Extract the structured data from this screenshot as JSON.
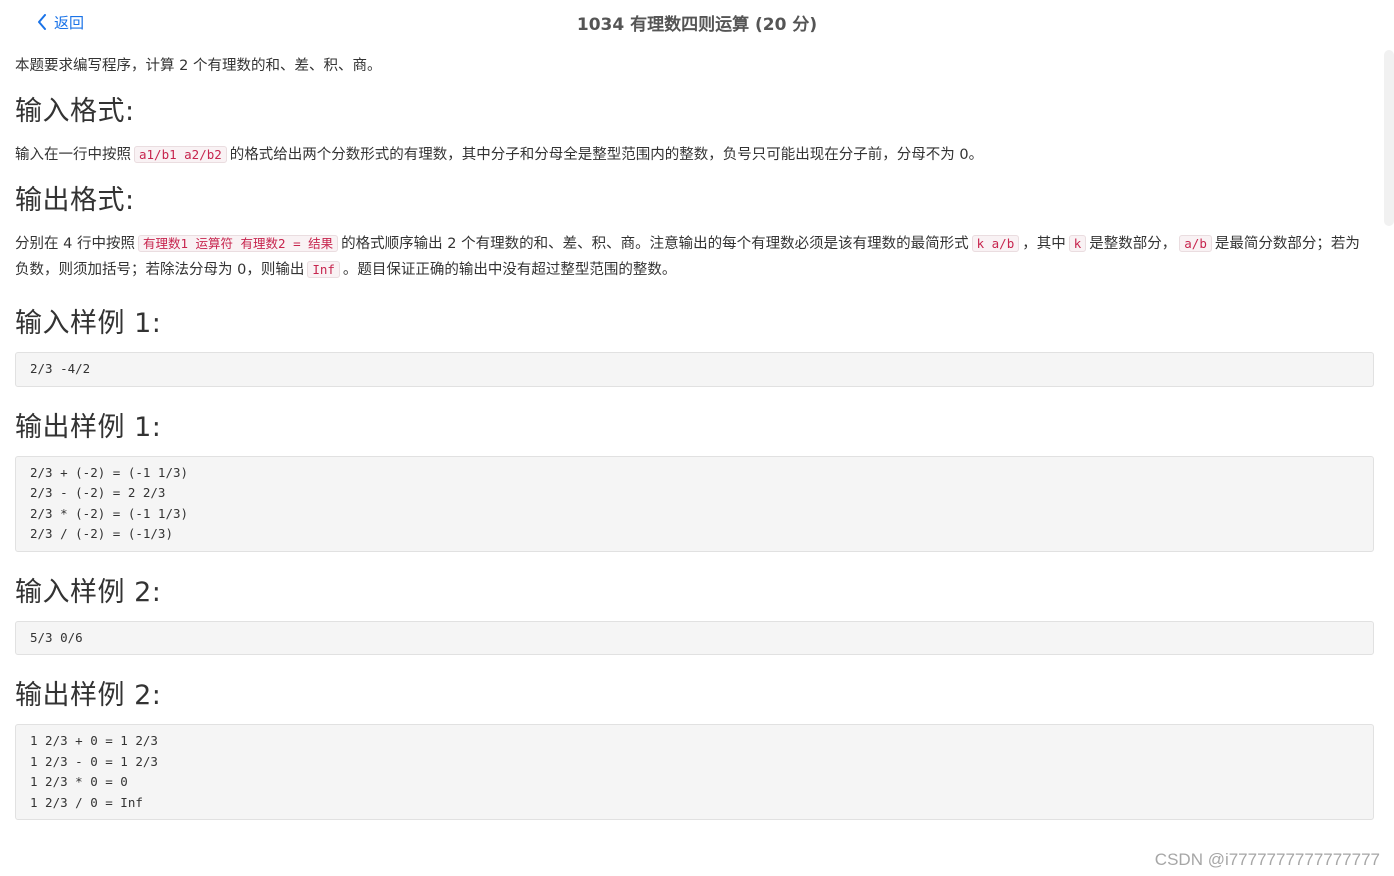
{
  "header": {
    "back_label": "返回",
    "title": "1034 有理数四则运算 (20 分)"
  },
  "intro": "本题要求编写程序，计算 2 个有理数的和、差、积、商。",
  "input_format": {
    "heading": "输入格式:",
    "text_before": "输入在一行中按照",
    "code": "a1/b1 a2/b2",
    "text_after": "的格式给出两个分数形式的有理数，其中分子和分母全是整型范围内的整数，负号只可能出现在分子前，分母不为 0。"
  },
  "output_format": {
    "heading": "输出格式:",
    "t1": "分别在 4 行中按照",
    "c1": "有理数1 运算符 有理数2 = 结果",
    "t2": "的格式顺序输出 2 个有理数的和、差、积、商。注意输出的每个有理数必须是该有理数的最简形式",
    "c2": "k a/b",
    "t3": "，其中",
    "c3": "k",
    "t4": "是整数部分，",
    "c4": "a/b",
    "t5": "是最简分数部分；若为负数，则须加括号；若除法分母为 0，则输出",
    "c5": "Inf",
    "t6": "。题目保证正确的输出中没有超过整型范围的整数。"
  },
  "samples": [
    {
      "heading": "输入样例 1:",
      "code": "2/3 -4/2"
    },
    {
      "heading": "输出样例 1:",
      "code": "2/3 + (-2) = (-1 1/3)\n2/3 - (-2) = 2 2/3\n2/3 * (-2) = (-1 1/3)\n2/3 / (-2) = (-1/3)"
    },
    {
      "heading": "输入样例 2:",
      "code": "5/3 0/6"
    },
    {
      "heading": "输出样例 2:",
      "code": "1 2/3 + 0 = 1 2/3\n1 2/3 - 0 = 1 2/3\n1 2/3 * 0 = 0\n1 2/3 / 0 = Inf"
    }
  ],
  "watermark": "CSDN @i7777777777777777",
  "colors": {
    "link": "#1a73e8",
    "code_text": "#c7254e",
    "code_bg": "#f9f2f4"
  },
  "icons": {
    "back": "chevron-left-icon"
  }
}
